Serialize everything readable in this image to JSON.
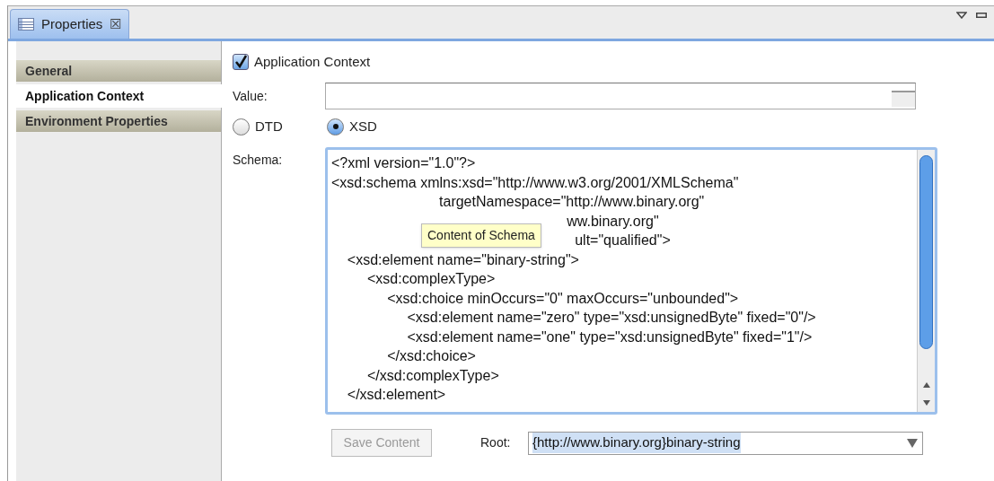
{
  "view_tab": {
    "title": "Properties",
    "close": "☒",
    "selected": true
  },
  "sidebar": {
    "items": [
      {
        "label": "General",
        "selected": false
      },
      {
        "label": "Application Context",
        "selected": true
      },
      {
        "label": "Environment Properties",
        "selected": false
      }
    ]
  },
  "application_context": {
    "label": "Application Context",
    "checked": true
  },
  "value": {
    "label": "Value:"
  },
  "schema_type": [
    {
      "label": "DTD",
      "selected": false
    },
    {
      "label": "XSD",
      "selected": true
    }
  ],
  "schema": {
    "label": "Schema:",
    "lines": [
      "<?xml version=\"1.0\"?>",
      "<xsd:schema xmlns:xsd=\"http://www.w3.org/2001/XMLSchema\"",
      "                           targetNamespace=\"http://www.binary.org\"",
      "                                                           ww.binary.org\"",
      "                                                             ult=\"qualified\">",
      "    <xsd:element name=\"binary-string\">",
      "         <xsd:complexType>",
      "              <xsd:choice minOccurs=\"0\" maxOccurs=\"unbounded\">",
      "                   <xsd:element name=\"zero\" type=\"xsd:unsignedByte\" fixed=\"0\"/>",
      "                   <xsd:element name=\"one\" type=\"xsd:unsignedByte\" fixed=\"1\"/>",
      "              </xsd:choice>",
      "         </xsd:complexType>",
      "    </xsd:element>"
    ],
    "tooltip": "Content of Schema"
  },
  "save_button": {
    "label": "Save Content",
    "disabled": true
  },
  "root": {
    "label": "Root:",
    "value": "{http://www.binary.org}binary-string"
  }
}
